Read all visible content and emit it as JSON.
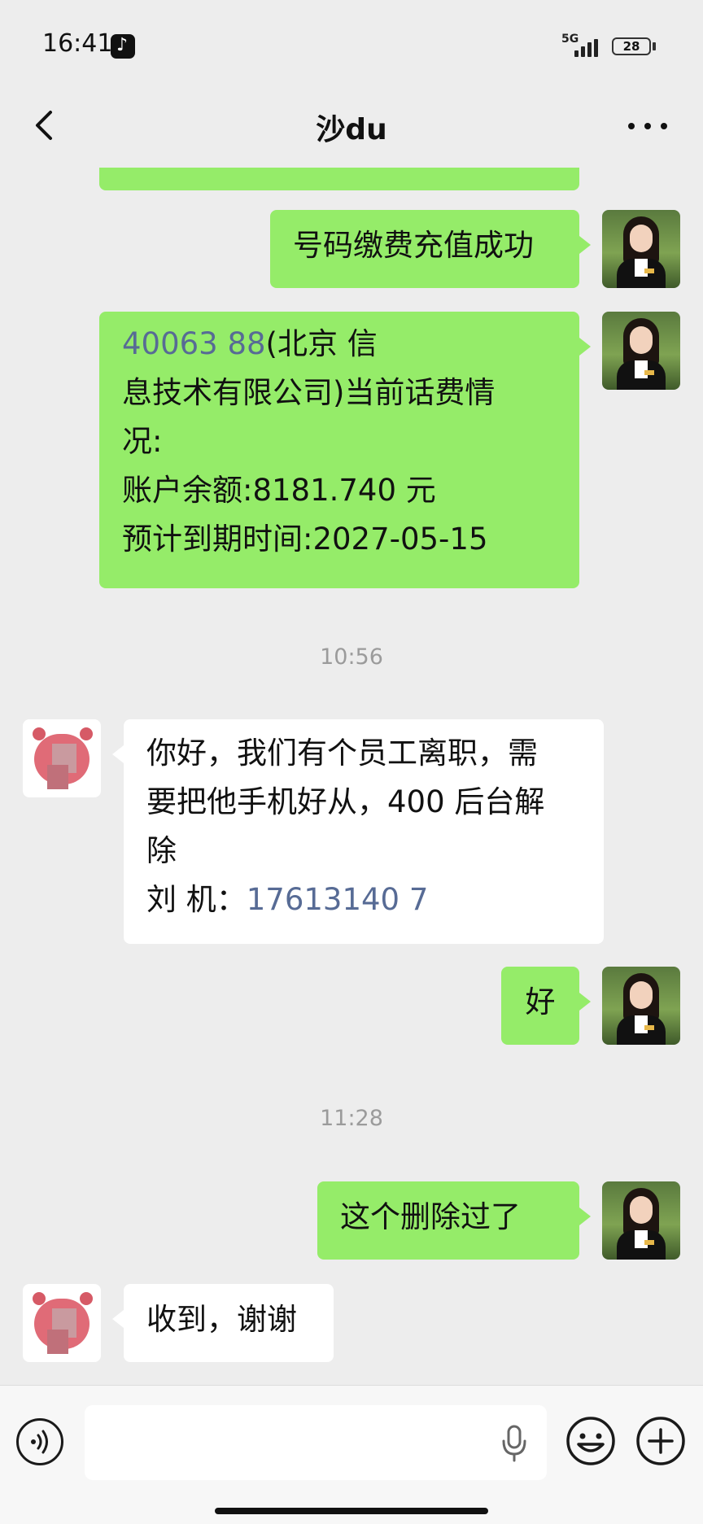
{
  "status_bar": {
    "time": "16:41",
    "network": "5G",
    "battery": "28"
  },
  "header": {
    "title": "沙du"
  },
  "messages": {
    "m1": {
      "text": "号码缴费充值成功"
    },
    "m2": {
      "link": "40063  88",
      "line1_rest": "(北京   信",
      "line2": "息技术有限公司)当前话费情",
      "line3": "况:",
      "line4": "账户余额:8181.740 元",
      "line5": "预计到期时间:2027-05-15"
    },
    "ts1": "10:56",
    "m3": {
      "line1": "你好，我们有个员工离职，需",
      "line2": "要把他手机好从，400 后台解",
      "line3": "除",
      "line4_prefix": "刘    机：",
      "line4_link": "17613140  7"
    },
    "m4": {
      "text": "好"
    },
    "ts2": "11:28",
    "m5": {
      "text": "这个删除过了"
    },
    "m6": {
      "text": "收到，谢谢"
    }
  },
  "input": {
    "placeholder": ""
  },
  "icons": {
    "back": "chevron-left-icon",
    "more": "more-dots-icon",
    "voice": "voice-icon",
    "mic": "microphone-icon",
    "emoji": "emoji-icon",
    "plus": "plus-icon"
  },
  "colors": {
    "sent_bubble": "#95ec69",
    "received_bubble": "#ffffff",
    "link": "#576b95",
    "background": "#ededed"
  }
}
